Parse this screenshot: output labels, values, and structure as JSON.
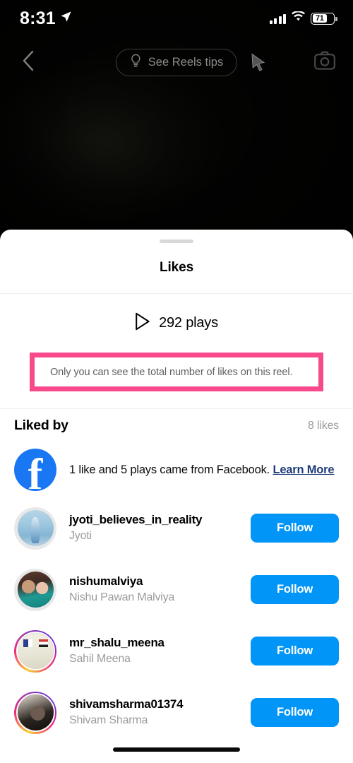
{
  "status_bar": {
    "time": "8:31",
    "location_icon": "location-arrow-icon",
    "cellular_icon": "cellular-bars-icon",
    "wifi_icon": "wifi-icon",
    "battery_percent": "71",
    "battery_level": 71
  },
  "reel_header": {
    "back_icon": "chevron-left-icon",
    "tips_pill_label": "See Reels tips",
    "tips_pill_icon": "lightbulb-icon",
    "camera_icon": "camera-icon",
    "cursor_icon": "cursor-arrow-icon"
  },
  "sheet": {
    "drag_handle": "drag-handle",
    "title": "Likes",
    "plays": {
      "icon": "play-triangle-icon",
      "label": "292 plays",
      "count": 292
    },
    "notice": {
      "text": "Only you can see the total number of likes on this reel.",
      "highlight_color": "#f84a8b"
    },
    "liked_by": {
      "label": "Liked by",
      "count_label": "8 likes",
      "count": 8
    },
    "facebook_attribution": {
      "icon": "facebook-logo-icon",
      "text": "1 like and 5 plays came from Facebook. ",
      "link_label": "Learn More",
      "link_color": "#1d3c78"
    },
    "users": [
      {
        "avatar": "avatar-jyoti",
        "has_story_ring": false,
        "username": "jyoti_believes_in_reality",
        "fullname": "Jyoti",
        "action_label": "Follow"
      },
      {
        "avatar": "avatar-nishumalviya",
        "has_story_ring": false,
        "username": "nishumalviya",
        "fullname": "Nishu Pawan Malviya",
        "action_label": "Follow"
      },
      {
        "avatar": "avatar-mr-shalu-meena",
        "has_story_ring": true,
        "username": "mr_shalu_meena",
        "fullname": "Sahil Meena",
        "action_label": "Follow"
      },
      {
        "avatar": "avatar-shivamsharma01374",
        "has_story_ring": true,
        "username": "shivamsharma01374",
        "fullname": "Shivam Sharma",
        "action_label": "Follow"
      }
    ]
  },
  "colors": {
    "follow_blue": "#0095f6",
    "facebook_blue": "#1977f3",
    "annotation_pink": "#f84a8b",
    "secondary_text": "#9b9b9f"
  },
  "home_indicator": "home-indicator"
}
